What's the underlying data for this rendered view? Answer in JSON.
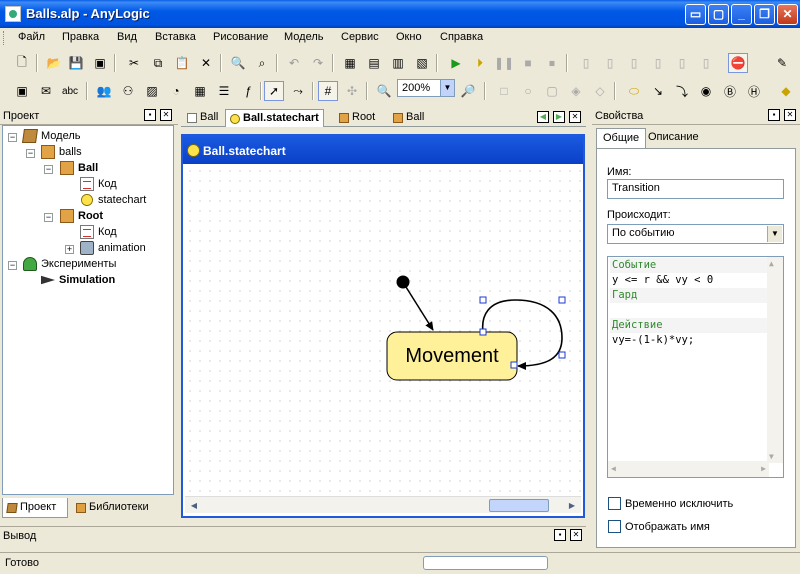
{
  "window": {
    "title": "Balls.alp - AnyLogic"
  },
  "menu": [
    "Файл",
    "Правка",
    "Вид",
    "Вставка",
    "Рисование",
    "Модель",
    "Сервис",
    "Окно",
    "Справка"
  ],
  "toolbar": {
    "zoom": "200%",
    "text_tool": "abc"
  },
  "project_panel": {
    "title": "Проект",
    "tree": {
      "model": "Модель",
      "package": "balls",
      "ball": "Ball",
      "ball_code": "Код",
      "ball_statechart": "statechart",
      "root": "Root",
      "root_code": "Код",
      "root_animation": "animation",
      "experiments": "Эксперименты",
      "simulation": "Simulation"
    },
    "tabs": [
      "Проект",
      "Библиотеки"
    ]
  },
  "editor": {
    "tabs": [
      "Ball",
      "Ball.statechart",
      "Root",
      "Ball"
    ],
    "title": "Ball.statechart",
    "state_label": "Movement"
  },
  "properties": {
    "title": "Свойства",
    "tabs": [
      "Общие",
      "Описание"
    ],
    "name_label": "Имя:",
    "name_value": "Transition",
    "trigger_label": "Происходит:",
    "trigger_value": "По событию",
    "code": {
      "event_header": "Событие",
      "event_value": "y <= r && vy < 0",
      "guard_header": "Гард",
      "guard_value": "",
      "action_header": "Действие",
      "action_value": "vy=-(1-k)*vy;"
    },
    "checkbox_exclude": "Временно исключить",
    "checkbox_show_name": "Отображать имя"
  },
  "output": {
    "title": "Вывод"
  },
  "status": {
    "text": "Готово"
  }
}
